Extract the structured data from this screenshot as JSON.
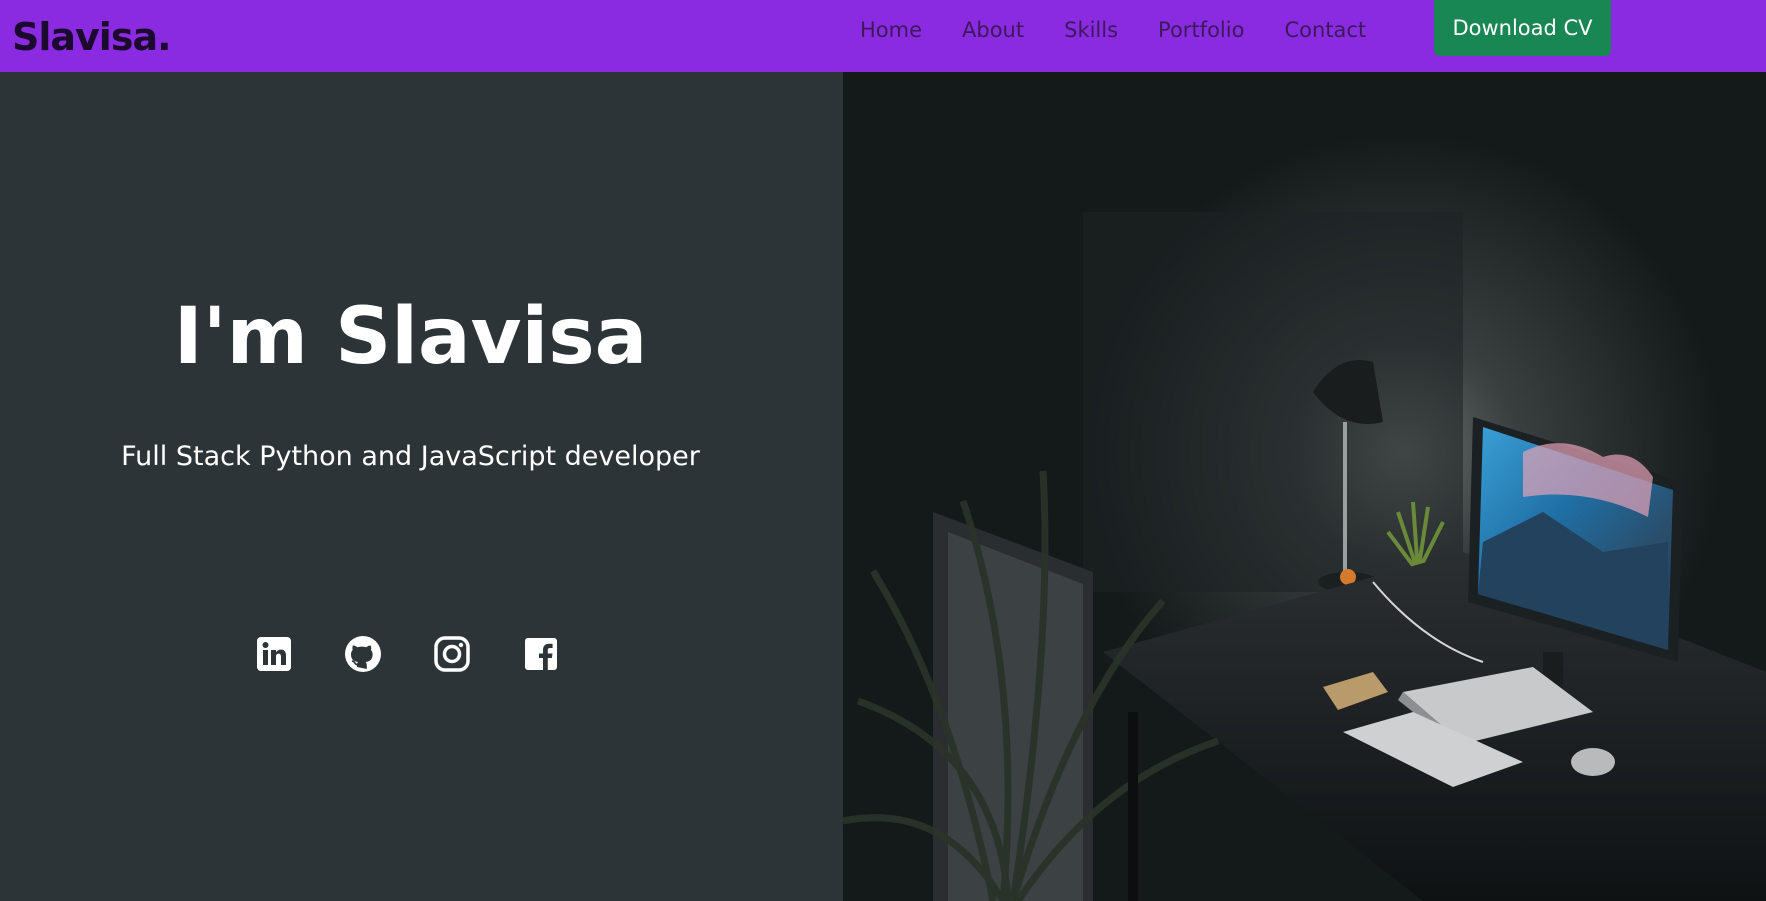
{
  "navbar": {
    "brand": "Slavisa.",
    "links": [
      "Home",
      "About",
      "Skills",
      "Portfolio",
      "Contact"
    ],
    "cta_label": "Download CV",
    "background_color": "#8a2be2",
    "cta_color": "#198754"
  },
  "hero": {
    "title": "I'm Slavisa",
    "subtitle": "Full Stack Python and JavaScript developer",
    "background_color": "#2d3437"
  },
  "socials": [
    {
      "icon": "linkedin-icon"
    },
    {
      "icon": "github-icon"
    },
    {
      "icon": "instagram-icon"
    },
    {
      "icon": "facebook-icon"
    }
  ],
  "photo": {
    "description_icon": "desk-workspace-photo"
  }
}
